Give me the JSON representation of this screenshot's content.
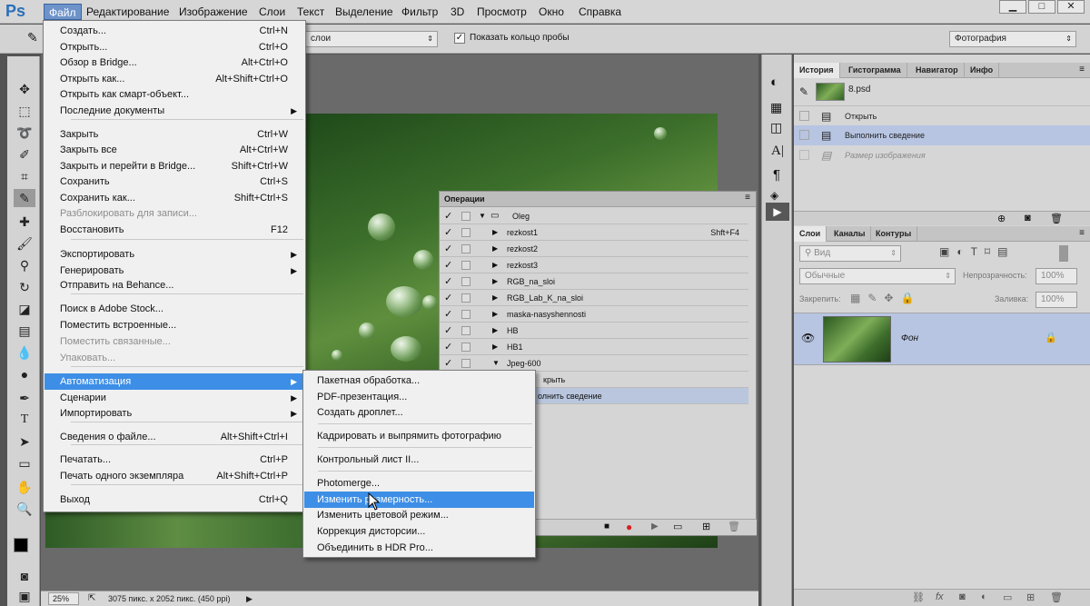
{
  "app": {
    "logo": "Ps"
  },
  "menubar": {
    "items": [
      "Файл",
      "Редактирование",
      "Изображение",
      "Слои",
      "Текст",
      "Выделение",
      "Фильтр",
      "3D",
      "Просмотр",
      "Окно",
      "Справка"
    ],
    "window_buttons": [
      "▁",
      "□",
      "✕"
    ]
  },
  "options": {
    "sample_select": "слои",
    "show_ring_label": "Показать кольцо пробы",
    "workspace_select": "Фотография"
  },
  "file_menu": {
    "items": [
      {
        "label": "Создать...",
        "shortcut": "Ctrl+N"
      },
      {
        "label": "Открыть...",
        "shortcut": "Ctrl+O"
      },
      {
        "label": "Обзор в Bridge...",
        "shortcut": "Alt+Ctrl+O"
      },
      {
        "label": "Открыть как...",
        "shortcut": "Alt+Shift+Ctrl+O"
      },
      {
        "label": "Открыть как смарт-объект...",
        "shortcut": ""
      },
      {
        "label": "Последние документы",
        "shortcut": ""
      },
      {
        "label": "Закрыть",
        "shortcut": "Ctrl+W"
      },
      {
        "label": "Закрыть все",
        "shortcut": "Alt+Ctrl+W"
      },
      {
        "label": "Закрыть и перейти в Bridge...",
        "shortcut": "Shift+Ctrl+W"
      },
      {
        "label": "Сохранить",
        "shortcut": "Ctrl+S"
      },
      {
        "label": "Сохранить как...",
        "shortcut": "Shift+Ctrl+S"
      },
      {
        "label": "Разблокировать для записи...",
        "shortcut": ""
      },
      {
        "label": "Восстановить",
        "shortcut": "F12"
      },
      {
        "label": "Экспортировать",
        "shortcut": ""
      },
      {
        "label": "Генерировать",
        "shortcut": ""
      },
      {
        "label": "Отправить на Behance...",
        "shortcut": ""
      },
      {
        "label": "Поиск в Adobe Stock...",
        "shortcut": ""
      },
      {
        "label": "Поместить встроенные...",
        "shortcut": ""
      },
      {
        "label": "Поместить связанные...",
        "shortcut": ""
      },
      {
        "label": "Упаковать...",
        "shortcut": ""
      },
      {
        "label": "Автоматизация",
        "shortcut": ""
      },
      {
        "label": "Сценарии",
        "shortcut": ""
      },
      {
        "label": "Импортировать",
        "shortcut": ""
      },
      {
        "label": "Сведения о файле...",
        "shortcut": "Alt+Shift+Ctrl+I"
      },
      {
        "label": "Печатать...",
        "shortcut": "Ctrl+P"
      },
      {
        "label": "Печать одного экземпляра",
        "shortcut": "Alt+Shift+Ctrl+P"
      },
      {
        "label": "Выход",
        "shortcut": "Ctrl+Q"
      }
    ]
  },
  "automation_menu": {
    "items": [
      "Пакетная обработка...",
      "PDF-презентация...",
      "Создать дроплет...",
      "Кадрировать и выпрямить фотографию",
      "Контрольный лист II...",
      "Photomerge...",
      "Изменить размерность...",
      "Изменить цветовой режим...",
      "Коррекция дисторсии...",
      "Объединить в HDR Pro..."
    ]
  },
  "actions_panel": {
    "title": "Операции",
    "set_name": "Oleg",
    "shortcut": "Shft+F4",
    "actions": [
      "rezkost1",
      "rezkost2",
      "rezkost3",
      "RGB_na_sloi",
      "RGB_Lab_K_na_sloi",
      "maska-nasyshennosti",
      "HB",
      "HB1",
      "Jpeg-600"
    ],
    "visible_steps": [
      "крыть",
      "олнить сведение"
    ]
  },
  "history_panel": {
    "tabs": [
      "История",
      "Гистограмма",
      "Навигатор",
      "Инфо"
    ],
    "snapshot": "8.psd",
    "states": [
      "Открыть",
      "Выполнить сведение",
      "Размер изображения"
    ]
  },
  "layers_panel": {
    "tabs": [
      "Слои",
      "Каналы",
      "Контуры"
    ],
    "filter_label": "Вид",
    "blend_mode": "Обычные",
    "opacity_label": "Непрозрачность:",
    "opacity_value": "100%",
    "lock_label": "Закрепить:",
    "fill_label": "Заливка:",
    "fill_value": "100%",
    "layer_name": "Фон"
  },
  "status_bar": {
    "zoom": "25%",
    "doc_info": "3075 пикс. x 2052 пикс. (450 ppi)"
  }
}
